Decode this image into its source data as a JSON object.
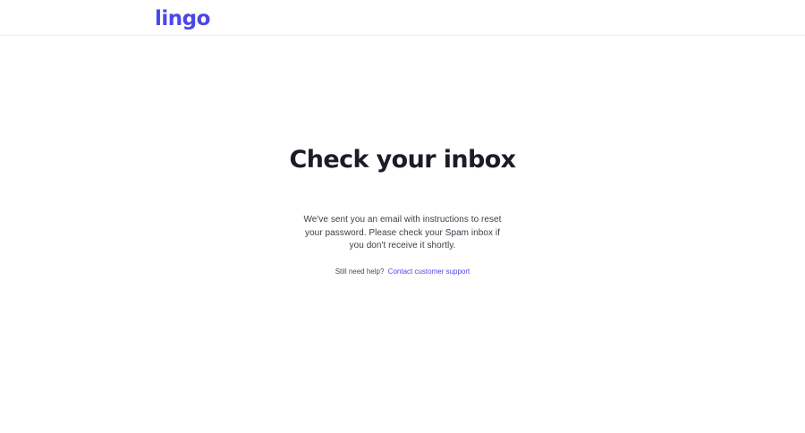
{
  "header": {
    "logo_text": "lingo"
  },
  "main": {
    "title": "Check your inbox",
    "message": "We've sent you an email with instructions to reset your password. Please check your Spam inbox if you don't receive it shortly.",
    "help_prefix": "Still need help?",
    "help_link": "Contact customer support"
  },
  "colors": {
    "brand": "#4c47e6",
    "title": "#1c1c28",
    "text": "#3c3c48",
    "divider": "#ececec"
  }
}
